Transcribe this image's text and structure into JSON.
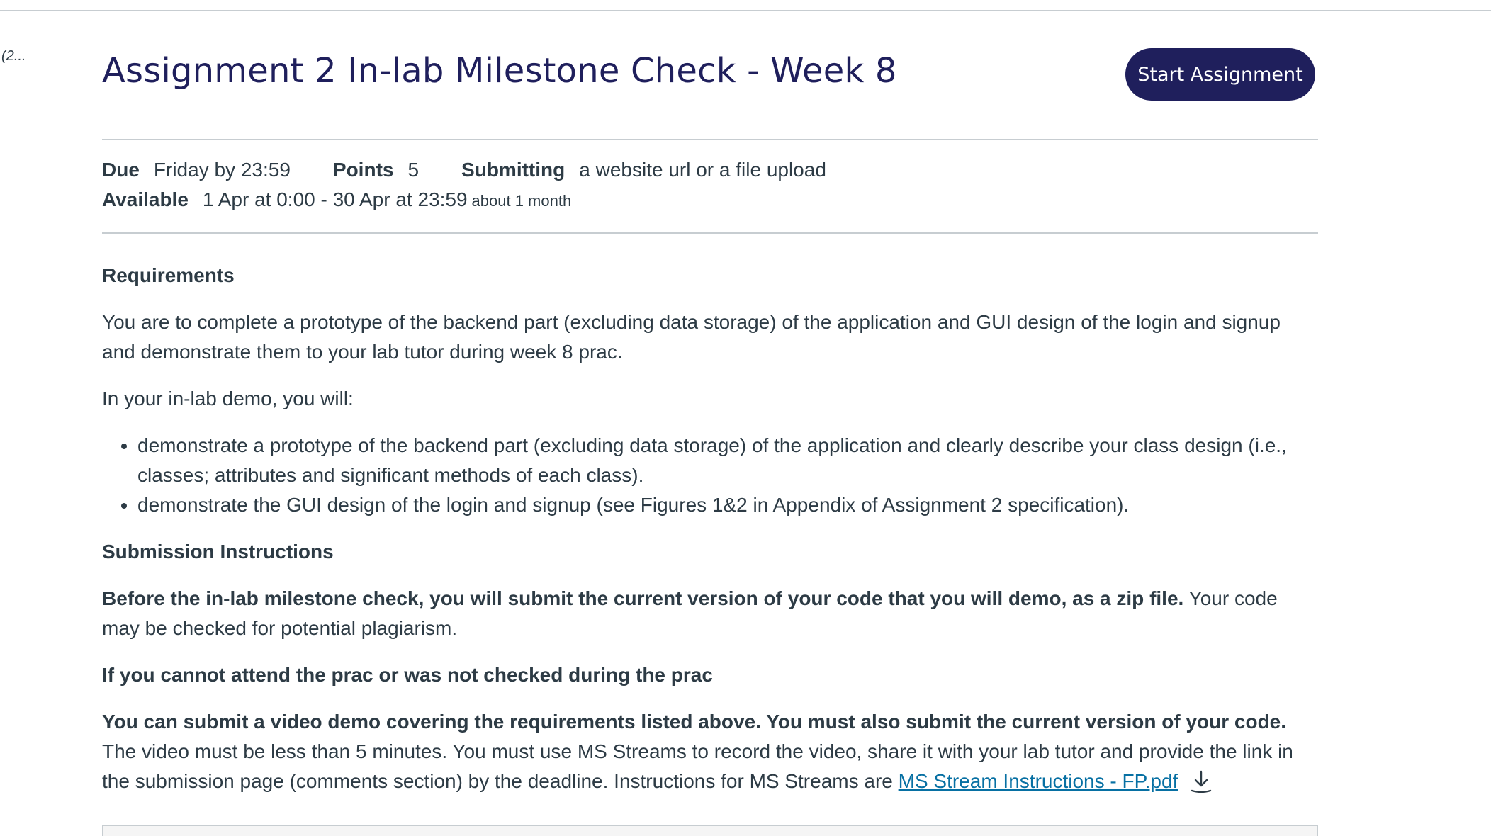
{
  "sidebar": {
    "truncated_label": "(2..."
  },
  "header": {
    "title": "Assignment 2 In-lab Milestone Check - Week 8",
    "start_button": "Start Assignment"
  },
  "details": {
    "due_label": "Due",
    "due_value": "Friday by 23:59",
    "points_label": "Points",
    "points_value": "5",
    "submitting_label": "Submitting",
    "submitting_value": "a website url or a file upload",
    "available_label": "Available",
    "available_value": "1 Apr at 0:00 - 30 Apr at 23:59",
    "available_hint": "about 1 month"
  },
  "body": {
    "requirements_heading": "Requirements",
    "requirements_text": "You are to complete a prototype of the backend part (excluding data storage) of the application and GUI design of the login and signup and demonstrate them to your lab tutor during week 8 prac.",
    "demo_intro": "In your in-lab demo, you will:",
    "demo_items": [
      "demonstrate a prototype of the backend part (excluding data storage) of the application and clearly describe your class design (i.e., classes; attributes and significant methods of each class).",
      "demonstrate the GUI design of the login and signup (see Figures 1&2 in Appendix of Assignment 2 specification)."
    ],
    "submission_heading": "Submission Instructions",
    "submission_bold": "Before the in-lab milestone check, you will submit the current version of your code that you will demo, as a zip file.",
    "submission_rest": " Your code may be checked for potential plagiarism.",
    "absent_heading": "If you cannot attend the prac or was not checked during the prac",
    "video_bold": "You can submit a video demo covering the requirements listed above. You must also submit the current version of your code.",
    "video_rest": " The video must be less than 5 minutes. You must use MS Streams to record the video, share it with your lab tutor and provide the link in the submission page (comments section) by the deadline. Instructions for MS Streams are ",
    "link_text": "MS Stream Instructions - FP.pdf"
  },
  "icons": {
    "download": "download-icon"
  },
  "colors": {
    "title": "#1f1f5c",
    "button_bg": "#1f1f5c",
    "link": "#0770a3",
    "text": "#2d3b45"
  }
}
